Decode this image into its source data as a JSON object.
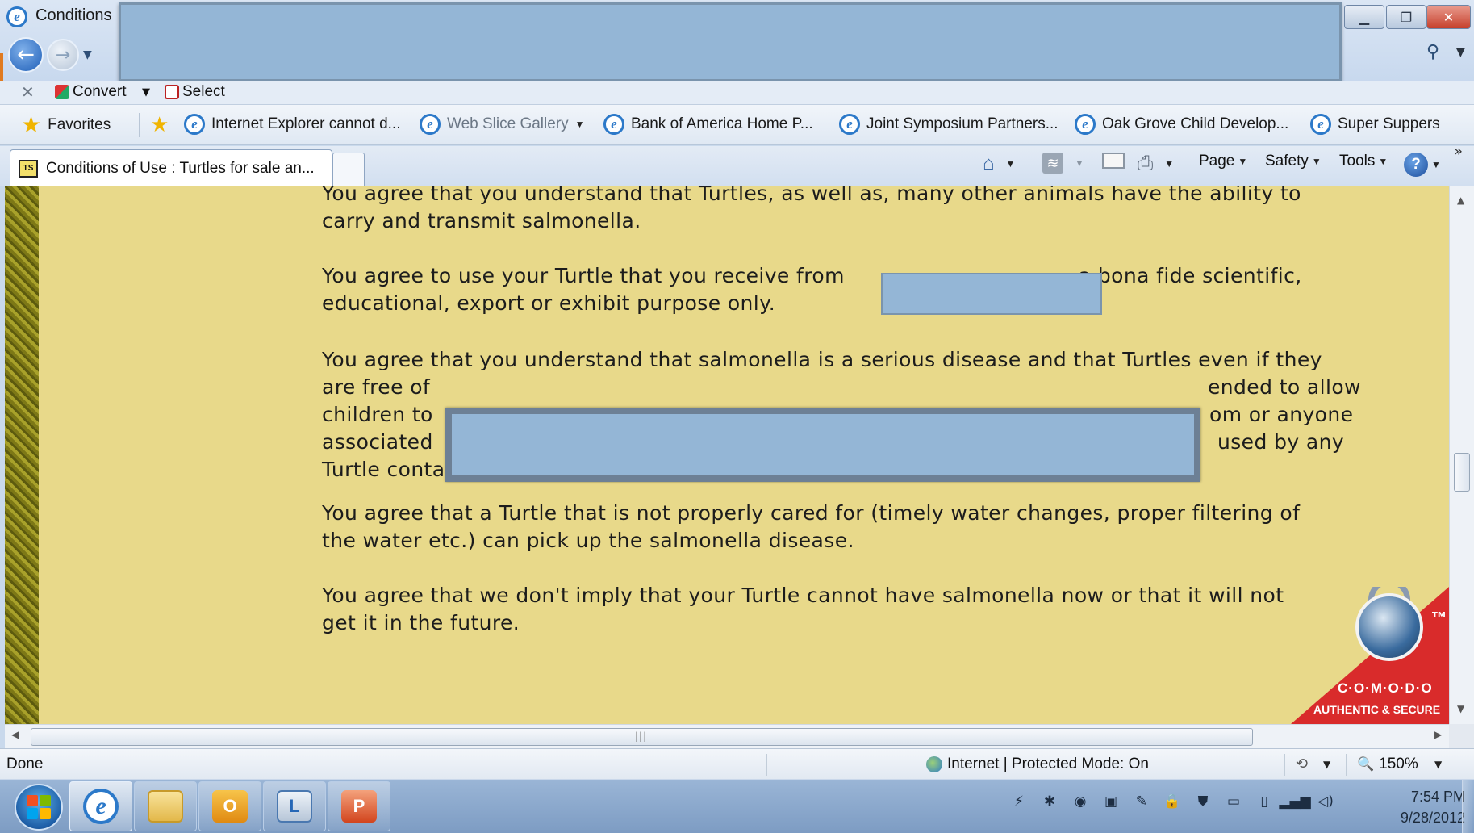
{
  "window": {
    "title": "Conditions",
    "controls": {
      "minimize": "▁",
      "maximize": "❐",
      "close": "✕"
    }
  },
  "convert_bar": {
    "close": "✕",
    "convert_label": "Convert",
    "select_label": "Select"
  },
  "favorites_bar": {
    "favorites_label": "Favorites",
    "items": [
      {
        "label": "Internet Explorer cannot d...",
        "icon": "ie-icon"
      },
      {
        "label": "Web Slice Gallery",
        "icon": "ie-icon"
      },
      {
        "label": "Bank of America  Home  P...",
        "icon": "ie-icon"
      },
      {
        "label": "Joint Symposium Partners...",
        "icon": "ie-icon"
      },
      {
        "label": "Oak Grove Child Develop...",
        "icon": "ie-icon"
      },
      {
        "label": "Super Suppers",
        "icon": "ie-icon"
      }
    ],
    "overflow": "»"
  },
  "tabs": {
    "active_tab": {
      "label": "Conditions of Use : Turtles for sale an...",
      "favicon": "TS"
    }
  },
  "command_bar": {
    "page_label": "Page",
    "safety_label": "Safety",
    "tools_label": "Tools",
    "help": "?"
  },
  "content": {
    "paragraphs": [
      {
        "lines": [
          "You agree that you understand that Turtles, as well as, many other animals have the ability to",
          "carry and transmit salmonella."
        ]
      },
      {
        "lines": [
          "You agree to use your Turtle that you receive from",
          "a bona fide scientific,",
          "educational, export or exhibit purpose only."
        ]
      },
      {
        "lines": [
          "You agree that you understand that salmonella is a serious disease and that Turtles even if they",
          "are free of",
          "ended to allow",
          "children to",
          "om or anyone",
          "associated",
          "used by any",
          "Turtle containing salmonella."
        ]
      },
      {
        "lines": [
          "You agree that a Turtle that is not properly cared for (timely water changes, proper filtering of",
          "the water etc.) can pick up the salmonella disease."
        ]
      },
      {
        "lines": [
          "You agree that we don't imply that your Turtle cannot have salmonella now or that it will not",
          "get it in the future."
        ]
      }
    ],
    "seal": {
      "tm": "TM",
      "name": "C·O·M·O·D·O",
      "tagline": "AUTHENTIC & SECURE"
    }
  },
  "statusbar": {
    "status": "Done",
    "zone": "Internet | Protected Mode: On",
    "zoom": "150%"
  },
  "taskbar": {
    "apps": [
      {
        "name": "internet-explorer",
        "active": true
      },
      {
        "name": "windows-explorer",
        "active": false
      },
      {
        "name": "outlook",
        "active": false
      },
      {
        "name": "lync",
        "active": false
      },
      {
        "name": "powerpoint",
        "active": false
      }
    ],
    "clock_time": "7:54 PM",
    "clock_date": "9/28/2012"
  },
  "colors": {
    "page_background": "#e8d98a",
    "redaction": "#94b6d6",
    "comodo_red": "#d92b2b"
  }
}
